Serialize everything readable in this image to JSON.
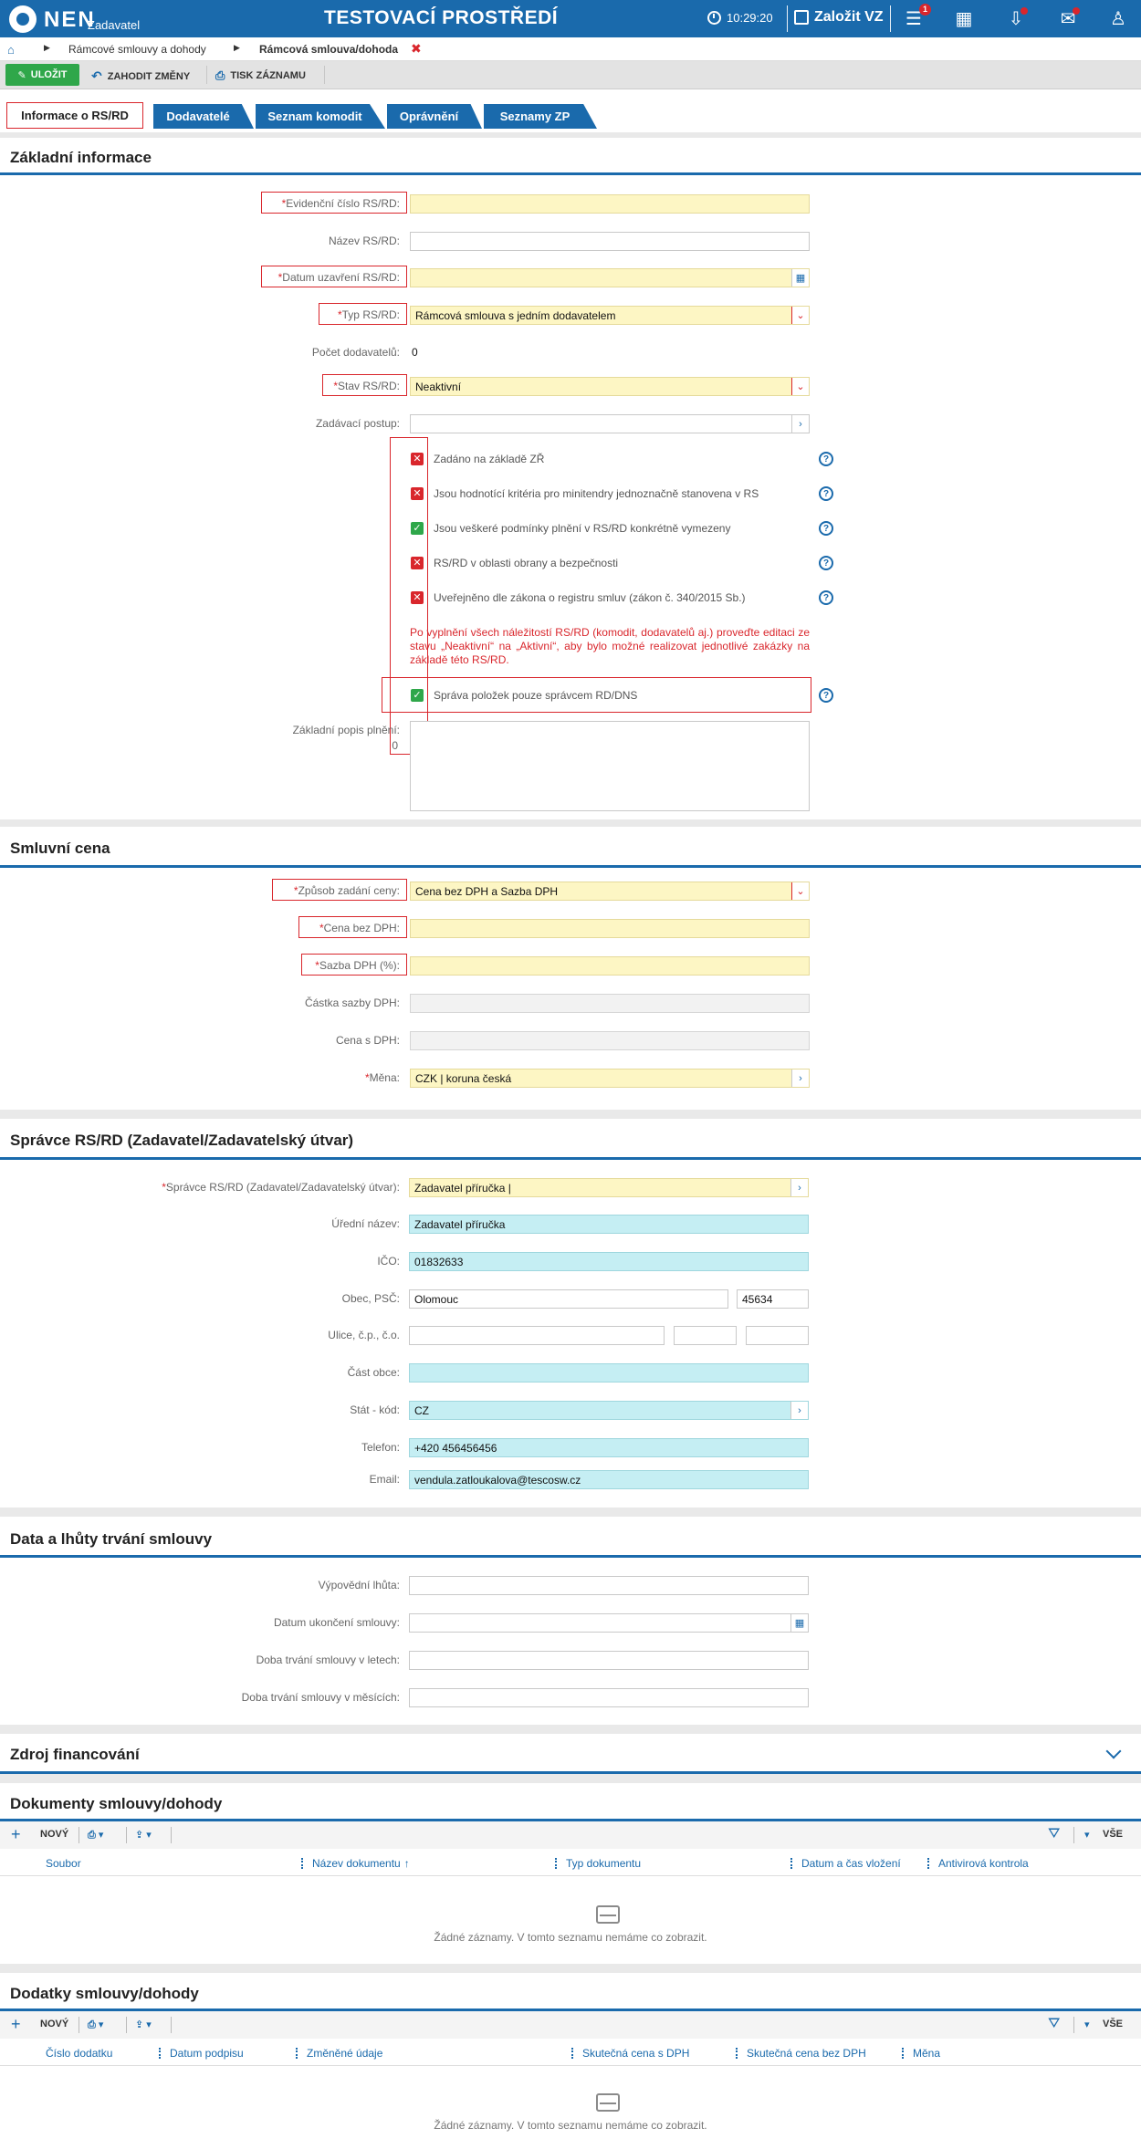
{
  "topbar": {
    "logo": "NEN",
    "logo_sub": "Zadavatel",
    "env_title": "TESTOVACÍ PROSTŘEDÍ",
    "time": "10:29:20",
    "create_label": "Založit VZ",
    "menu_badge": "1",
    "accent_color": "#1a6aac"
  },
  "breadcrumb": {
    "items": [
      "Rámcové smlouvy a dohody",
      "Rámcová smlouva/dohoda"
    ],
    "close": "✖"
  },
  "toolbar": {
    "save": "ULOŽIT",
    "discard": "ZAHODIT ZMĚNY",
    "print": "TISK ZÁZNAMU"
  },
  "tabs": [
    {
      "label": "Informace o RS/RD",
      "active": true
    },
    {
      "label": "Dodavatelé"
    },
    {
      "label": "Seznam komodit"
    },
    {
      "label": "Oprávnění"
    },
    {
      "label": "Seznamy ZP"
    }
  ],
  "basic": {
    "title": "Základní informace",
    "ev_cislo_label": "Evidenční číslo RS/RD:",
    "ev_cislo_value": "",
    "nazev_label": "Název RS/RD:",
    "nazev_value": "",
    "datum_label": "Datum uzavření RS/RD:",
    "datum_value": "",
    "typ_label": "Typ RS/RD:",
    "typ_value": "Rámcová smlouva s jedním dodavatelem",
    "pocet_label": "Počet dodavatelů:",
    "pocet_value": "0",
    "stav_label": "Stav RS/RD:",
    "stav_value": "Neaktivní",
    "postup_label": "Zadávací postup:",
    "postup_value": "",
    "checks": [
      {
        "label": "Zadáno na základě ZŘ",
        "checked": false
      },
      {
        "label": "Jsou hodnotící kritéria pro minitendry jednoznačně stanovena v RS",
        "checked": false
      },
      {
        "label": "Jsou veškeré podmínky plnění v RS/RD konkrétně vymezeny",
        "checked": true
      },
      {
        "label": "RS/RD v oblasti obrany a bezpečnosti",
        "checked": false
      },
      {
        "label": "Uveřejněno dle zákona o registru smluv (zákon č. 340/2015 Sb.)",
        "checked": false
      }
    ],
    "warning": "Po vyplnění všech náležitostí RS/RD (komodit, dodavatelů aj.) proveďte editaci ze stavu „Neaktivní“ na „Aktivní“, aby bylo možné realizovat jednotlivé zakázky na základě této RS/RD.",
    "sprava_label": "Správa položek pouze správcem RD/DNS",
    "sprava_checked": true,
    "popis_label": "Základní popis plnění:",
    "popis_count": "0"
  },
  "price": {
    "title": "Smluvní cena",
    "zpusob_label": "Způsob zadání ceny:",
    "zpusob_value": "Cena bez DPH a Sazba DPH",
    "cena_label": "Cena bez DPH:",
    "sazba_label": "Sazba DPH (%):",
    "castka_label": "Částka sazby DPH:",
    "cena_s_label": "Cena s DPH:",
    "mena_label": "Měna:",
    "mena_value": "CZK | koruna česká"
  },
  "admin": {
    "title": "Správce RS/RD (Zadavatel/Zadavatelský útvar)",
    "spravce_label": "Správce RS/RD (Zadavatel/Zadavatelský útvar):",
    "spravce_value": "Zadavatel příručka |",
    "uredni_label": "Úřední název:",
    "uredni_value": "Zadavatel příručka",
    "ico_label": "IČO:",
    "ico_value": "01832633",
    "obec_label": "Obec, PSČ:",
    "obec_value": "Olomouc",
    "psc_value": "45634",
    "ulice_label": "Ulice, č.p., č.o.",
    "cast_label": "Část obce:",
    "stat_label": "Stát - kód:",
    "stat_value": "CZ",
    "tel_label": "Telefon:",
    "tel_value": "+420 456456456",
    "email_label": "Email:",
    "email_value": "vendula.zatloukalova@tescosw.cz"
  },
  "dates": {
    "title": "Data a lhůty trvání smlouvy",
    "vypovedni_label": "Výpovědní lhůta:",
    "ukonceni_label": "Datum ukončení smlouvy:",
    "roky_label": "Doba trvání smlouvy v letech:",
    "mesice_label": "Doba trvání smlouvy v měsících:"
  },
  "funding": {
    "title": "Zdroj financování"
  },
  "documents": {
    "title": "Dokumenty smlouvy/dohody",
    "new": "NOVÝ",
    "all": "VŠE",
    "columns": [
      "Soubor",
      "Název dokumentu",
      "Typ dokumentu",
      "Datum a čas vložení",
      "Antivirová kontrola"
    ],
    "empty": "Žádné záznamy. V tomto seznamu nemáme co zobrazit."
  },
  "addenda": {
    "title": "Dodatky smlouvy/dohody",
    "new": "NOVÝ",
    "all": "VŠE",
    "columns": [
      "Číslo dodatku",
      "Datum podpisu",
      "Změněné údaje",
      "Skutečná cena s DPH",
      "Skutečná cena bez DPH",
      "Měna"
    ],
    "empty": "Žádné záznamy. V tomto seznamu nemáme co zobrazit."
  }
}
